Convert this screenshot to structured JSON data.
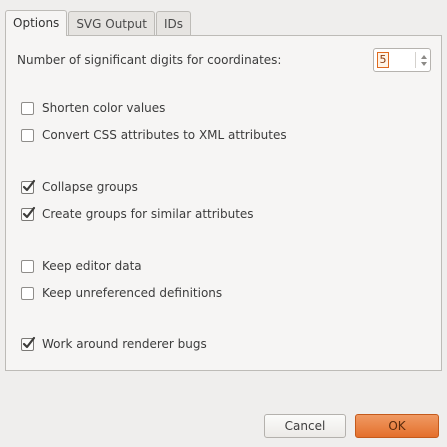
{
  "tabs": {
    "options": "Options",
    "svg_output": "SVG Output",
    "ids": "IDs"
  },
  "options": {
    "digits_label": "Number of significant digits for coordinates:",
    "digits_value": "5",
    "checkboxes": [
      {
        "label": "Shorten color values",
        "checked": false
      },
      {
        "label": "Convert CSS attributes to XML attributes",
        "checked": false
      },
      {
        "label": "Collapse groups",
        "checked": true
      },
      {
        "label": "Create groups for similar attributes",
        "checked": true
      },
      {
        "label": "Keep editor data",
        "checked": false
      },
      {
        "label": "Keep unreferenced definitions",
        "checked": false
      },
      {
        "label": "Work around renderer bugs",
        "checked": true
      }
    ]
  },
  "buttons": {
    "cancel": "Cancel",
    "ok": "OK"
  },
  "colors": {
    "accent": "#e46f2c",
    "window_bg": "#efeeed",
    "panel_bg": "#f6f5f4"
  }
}
